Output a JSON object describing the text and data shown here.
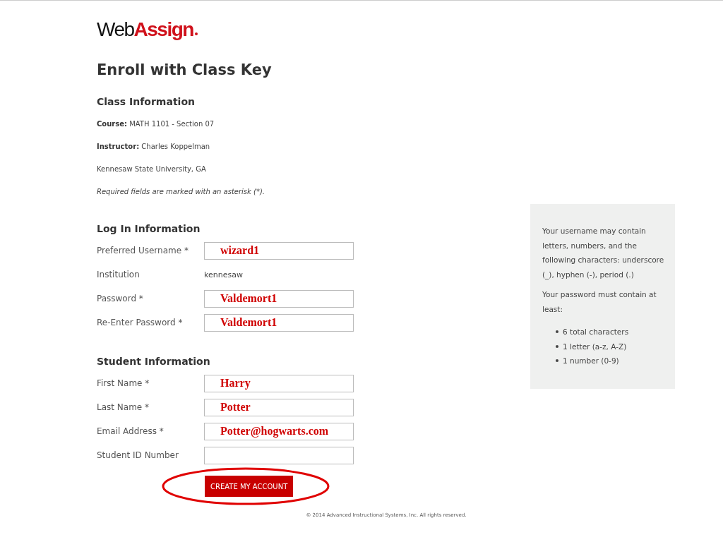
{
  "logo": {
    "text": "Web**Assign**"
  },
  "page_title": "Enroll with Class Key",
  "class_info": {
    "heading": "Class Information",
    "lines": [
      "**Course:** MATH 1101 - Section 07",
      "**Instructor:** Charles Koppelman",
      "Kennesaw State University, GA"
    ],
    "note": "Required fields are marked with an asterisk (*)."
  },
  "sections": [
    {
      "heading": "Log In Information",
      "fields": [
        {
          "kind": "input",
          "label": "Preferred Username *",
          "value": "wizard1"
        },
        {
          "kind": "static",
          "label": "Institution",
          "value": "kennesaw"
        },
        {
          "kind": "input",
          "label": "Password *",
          "value": "Valdemort1"
        },
        {
          "kind": "input",
          "label": "Re-Enter Password *",
          "value": "Valdemort1"
        }
      ]
    },
    {
      "heading": "Student Information",
      "fields": [
        {
          "kind": "input",
          "label": "First Name *",
          "value": "Harry"
        },
        {
          "kind": "input",
          "label": "Last Name *",
          "value": "Potter"
        },
        {
          "kind": "input",
          "label": "Email Address *",
          "value": "Potter@hogwarts.com"
        },
        {
          "kind": "input",
          "label": "Student ID Number"
        }
      ]
    }
  ],
  "submit": {
    "label": "CREATE MY ACCOUNT",
    "circled": true
  },
  "footer": "© 2014 Advanced Instructional Systems, Inc. All rights reserved.",
  "help": {
    "paragraphs": [
      "Your username may contain letters, numbers, and the following characters: underscore (_), hyphen (-), period (.)",
      "Your password must contain at least:"
    ],
    "requirements": [
      "6 total characters",
      "1 letter (a-z, A-Z)",
      "1 number (0-9)"
    ]
  }
}
